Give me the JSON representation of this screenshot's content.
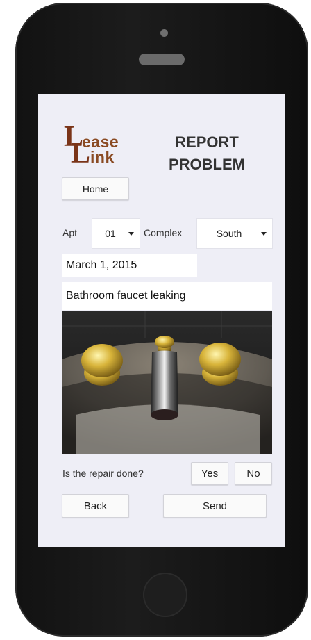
{
  "logo": {
    "line1": "ease",
    "line2": "ink",
    "initial": "L"
  },
  "title": {
    "line1": "REPORT",
    "line2": "PROBLEM"
  },
  "nav": {
    "home_label": "Home"
  },
  "form": {
    "apt_label": "Apt",
    "apt_value": "01",
    "complex_label": "Complex",
    "complex_value": "South",
    "date_value": "March 1, 2015",
    "description_value": "Bathroom faucet leaking",
    "repair_question": "Is the repair done?",
    "yes_label": "Yes",
    "no_label": "No"
  },
  "actions": {
    "back_label": "Back",
    "send_label": "Send"
  },
  "colors": {
    "logo_brown": "#7a3418",
    "screen_bg": "#eeeef6",
    "phone_body": "#121212"
  },
  "icons": {
    "dropdown": "chevron-down-icon",
    "faucet_photo": "faucet-photo"
  }
}
